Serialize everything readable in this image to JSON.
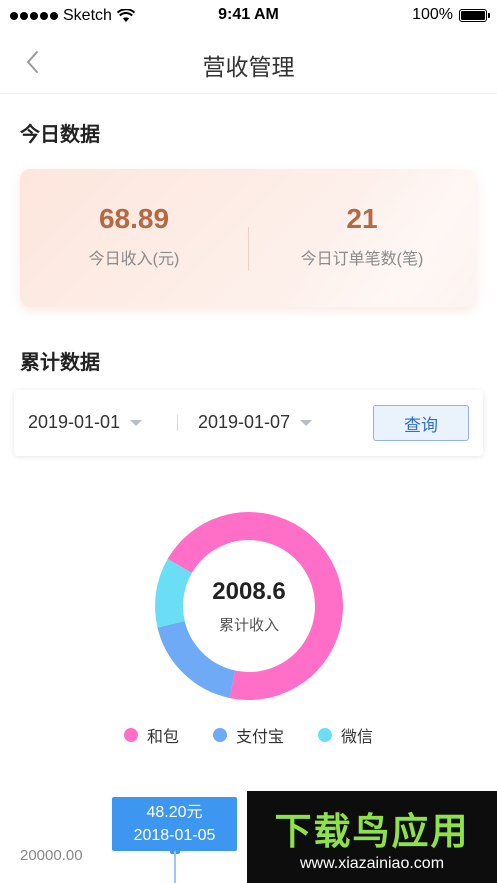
{
  "status_bar": {
    "carrier": "Sketch",
    "time": "9:41 AM",
    "battery": "100%"
  },
  "nav": {
    "title": "营收管理"
  },
  "today": {
    "section_title": "今日数据",
    "income_value": "68.89",
    "income_label": "今日收入(元)",
    "orders_value": "21",
    "orders_label": "今日订单笔数(笔)"
  },
  "cumulative": {
    "section_title": "累计数据",
    "start_date": "2019-01-01",
    "end_date": "2019-01-07",
    "query_label": "查询"
  },
  "chart_data": {
    "type": "pie",
    "center_value": "2008.6",
    "center_label": "累计收入",
    "series": [
      {
        "name": "和包",
        "share": 0.7,
        "color": "#ff6fc8"
      },
      {
        "name": "支付宝",
        "share": 0.18,
        "color": "#6eaaf5"
      },
      {
        "name": "微信",
        "share": 0.12,
        "color": "#69def5"
      }
    ]
  },
  "trend": {
    "tooltip_value": "48.20元",
    "tooltip_date": "2018-01-05",
    "y_tick": "20000.00"
  },
  "watermark": {
    "logo": "下载鸟应用",
    "url": "www.xiazainiao.com"
  },
  "colors": {
    "accent": "#3d96f0",
    "income": "#b36a44"
  }
}
